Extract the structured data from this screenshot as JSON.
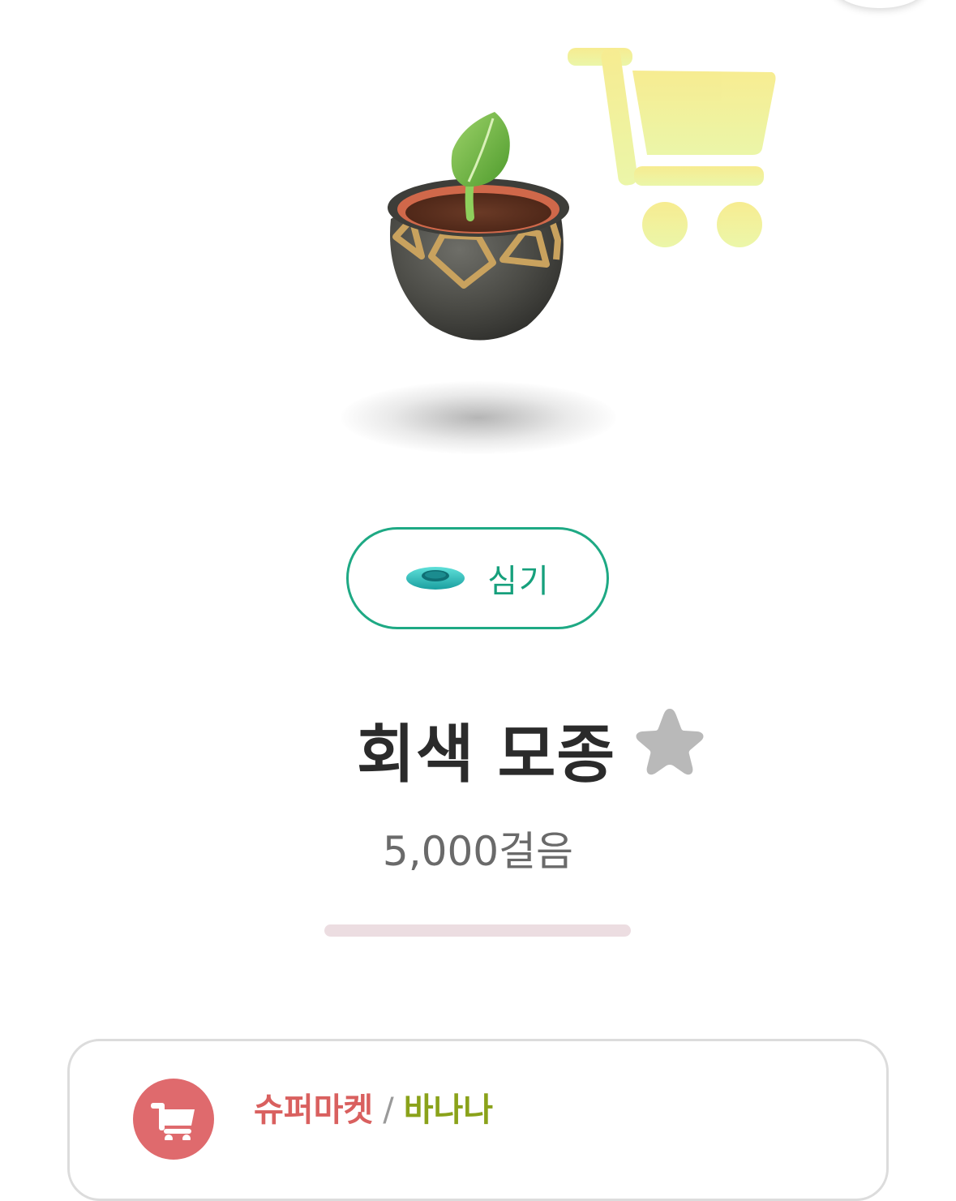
{
  "colors": {
    "accent_green": "#1ea984",
    "title_text": "#2b2b2b",
    "price_text": "#6a6a6a",
    "star_inactive": "#b9b9b9",
    "store_red": "#d9605f",
    "category_green": "#8aa21a",
    "cart_watermark": "#f5eb8a"
  },
  "icons": {
    "cart_watermark": "shopping-cart-icon",
    "plant_action": "pot-icon",
    "favorite": "star-icon",
    "source": "shopping-cart-icon"
  },
  "item": {
    "name": "회색 모종",
    "price": "5,000걸음",
    "favorite": false
  },
  "actions": {
    "plant_label": "심기"
  },
  "progress": {
    "value": 0
  },
  "source": {
    "store": "슈퍼마켓",
    "separator": "/",
    "category": "바나나"
  }
}
